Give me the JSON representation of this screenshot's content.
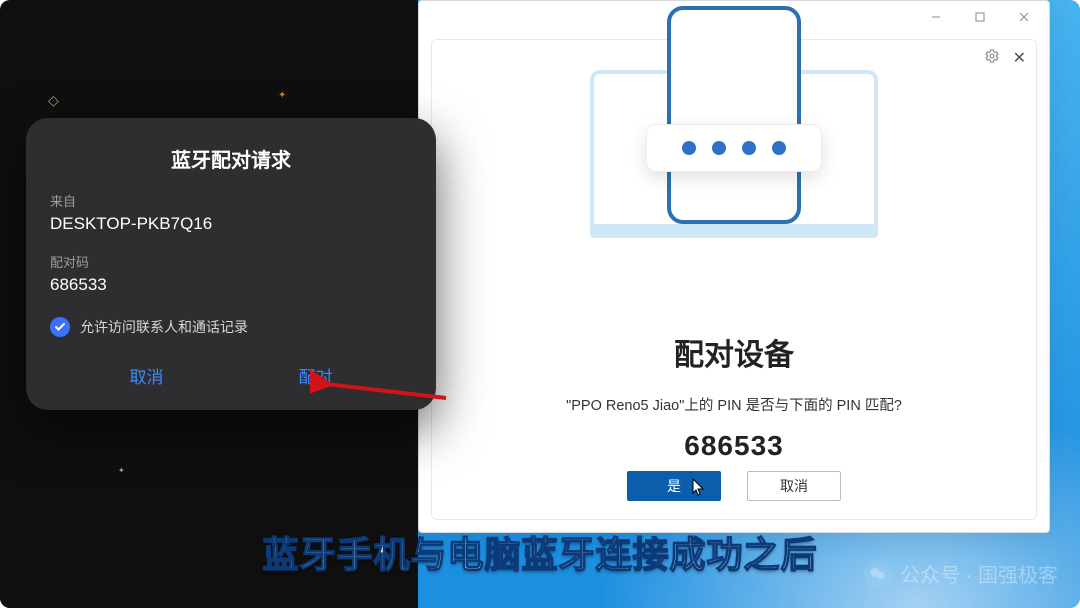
{
  "phone_dialog": {
    "title": "蓝牙配对请求",
    "from_label": "来自",
    "from_value": "DESKTOP-PKB7Q16",
    "code_label": "配对码",
    "code_value": "686533",
    "checkbox_label": "允许访问联系人和通话记录",
    "cancel": "取消",
    "pair": "配对"
  },
  "windows_dialog": {
    "heading": "配对设备",
    "question": "\"PPO Reno5 Jiao\"上的 PIN 是否与下面的 PIN 匹配?",
    "pin": "686533",
    "yes": "是",
    "cancel": "取消"
  },
  "subtitle": "蓝牙手机与电脑蓝牙连接成功之后",
  "watermark": "公众号 · 国强极客"
}
